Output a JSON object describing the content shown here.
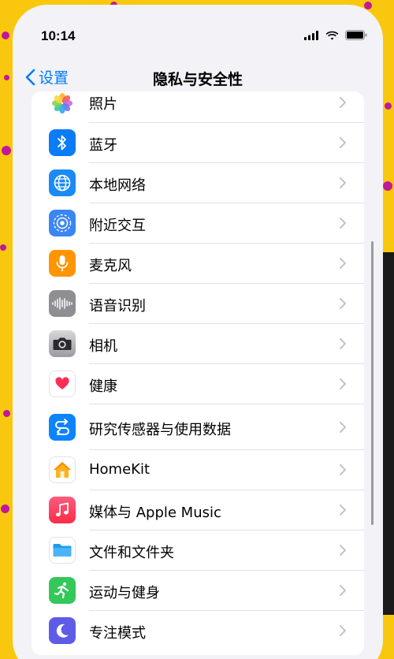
{
  "status": {
    "time": "10:14"
  },
  "nav": {
    "back_label": "设置",
    "title": "隐私与安全性"
  },
  "items": [
    {
      "label": "照片",
      "icon": "photos-icon"
    },
    {
      "label": "蓝牙",
      "icon": "bluetooth-icon",
      "color": "#0a7cf7"
    },
    {
      "label": "本地网络",
      "icon": "globe-icon",
      "color": "#1a8af5"
    },
    {
      "label": "附近交互",
      "icon": "nearby-interaction-icon",
      "color": "#3a86f4"
    },
    {
      "label": "麦克风",
      "icon": "microphone-icon",
      "color": "#ff9500"
    },
    {
      "label": "语音识别",
      "icon": "waveform-icon",
      "color": "#8e8e93"
    },
    {
      "label": "相机",
      "icon": "camera-icon",
      "color": "#8e8e93"
    },
    {
      "label": "健康",
      "icon": "heart-icon",
      "color": "#ff2d55"
    },
    {
      "label": "研究传感器与使用数据",
      "icon": "research-icon",
      "color": "#0a84ff"
    },
    {
      "label": "HomeKit",
      "icon": "home-icon",
      "color": "#ff9500"
    },
    {
      "label": "媒体与 Apple Music",
      "icon": "music-icon",
      "color": "#fa2d48"
    },
    {
      "label": "文件和文件夹",
      "icon": "folder-icon",
      "color": "#1e9af0"
    },
    {
      "label": "运动与健身",
      "icon": "fitness-icon",
      "color": "#34c759"
    },
    {
      "label": "专注模式",
      "icon": "moon-icon",
      "color": "#5e5ce6"
    }
  ]
}
